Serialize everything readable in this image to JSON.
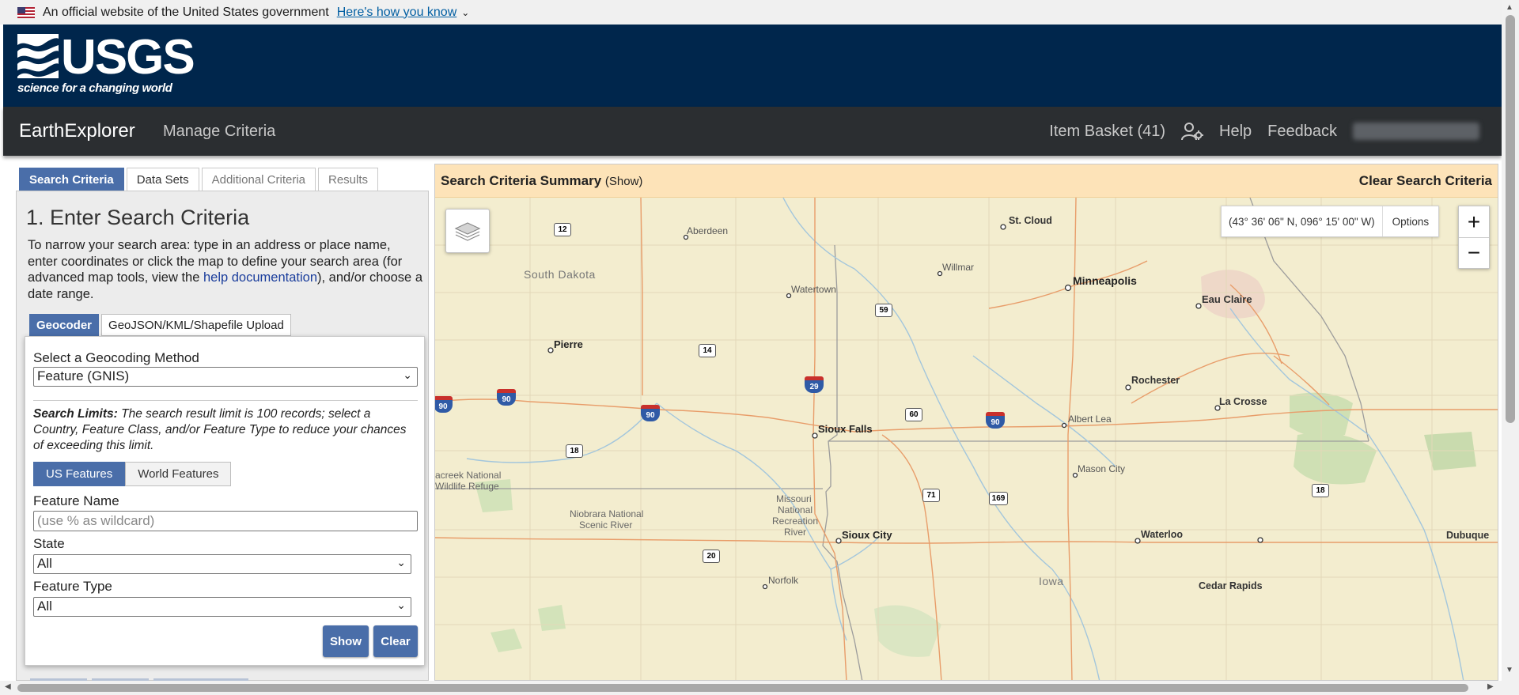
{
  "gov_banner": {
    "text": "An official website of the United States government",
    "link": "Here's how you know"
  },
  "header": {
    "logo_word": "USGS",
    "logo_tagline": "science for a changing world"
  },
  "navbar": {
    "brand": "EarthExplorer",
    "manage": "Manage Criteria",
    "basket": "Item Basket (41)",
    "help": "Help",
    "feedback": "Feedback"
  },
  "tabs": [
    "Search Criteria",
    "Data Sets",
    "Additional Criteria",
    "Results"
  ],
  "criteria": {
    "title": "1. Enter Search Criteria",
    "intro_before": "To narrow your search area: type in an address or place name, enter coordinates or click the map to define your search area (for advanced map tools, view the ",
    "intro_link": "help documentation",
    "intro_after": "), and/or choose a date range.",
    "subtabs": [
      "Geocoder",
      "GeoJSON/KML/Shapefile Upload"
    ],
    "method_label": "Select a Geocoding Method",
    "method_value": "Feature (GNIS)",
    "limits_label": "Search Limits:",
    "limits_text": " The search result limit is 100 records; select a Country, Feature Class, and/or Feature Type to reduce your chances of exceeding this limit.",
    "toggle": [
      "US Features",
      "World Features"
    ],
    "feature_name_label": "Feature Name",
    "feature_name_placeholder": "(use % as wildcard)",
    "state_label": "State",
    "state_value": "All",
    "feature_type_label": "Feature Type",
    "feature_type_value": "All",
    "show_button": "Show",
    "clear_button": "Clear"
  },
  "map": {
    "summary_title": "Search Criteria Summary",
    "summary_show": "(Show)",
    "clear_all": "Clear Search Criteria",
    "coordinates": "(43° 36' 06\" N, 096° 15' 00\" W)",
    "options": "Options",
    "zoom_in": "+",
    "zoom_out": "−",
    "labels": {
      "st_cloud": "St. Cloud",
      "aberdeen": "Aberdeen",
      "south_dakota": "South Dakota",
      "willmar": "Willmar",
      "watertown": "Watertown",
      "minneapolis": "Minneapolis",
      "eau_claire": "Eau Claire",
      "pierre": "Pierre",
      "rochester": "Rochester",
      "la_crosse": "La Crosse",
      "sioux_falls": "Sioux Falls",
      "albert_lea": "Albert Lea",
      "mason_city": "Mason City",
      "lacreek_1": "acreek National",
      "lacreek_2": "Wildlife Refuge",
      "missouri_1": "Missouri",
      "missouri_2": "National",
      "missouri_3": "Recreation",
      "missouri_4": "River",
      "niobrara_1": "Niobrara National",
      "niobrara_2": "Scenic River",
      "sioux_city": "Sioux City",
      "waterloo": "Waterloo",
      "dubuque": "Dubuque",
      "norfolk": "Norfolk",
      "iowa": "Iowa",
      "cedar_rapids": "Cedar Rapids"
    },
    "shields": {
      "us12": "12",
      "us14": "14",
      "us18a": "18",
      "us18b": "18",
      "us20": "20",
      "us59": "59",
      "us60": "60",
      "us71": "71",
      "us169": "169",
      "i29": "29",
      "i90a": "90",
      "i90b": "90",
      "i90c": "90",
      "i90d": "90"
    }
  },
  "colors": {
    "gov_banner_bg": "#f0f0f0",
    "usgs_blue": "#00264c",
    "navbar_bg": "#2b2e31",
    "accent": "#4a6ea9",
    "summary_bg": "#fde3b8",
    "map_land": "#f3edcf"
  }
}
